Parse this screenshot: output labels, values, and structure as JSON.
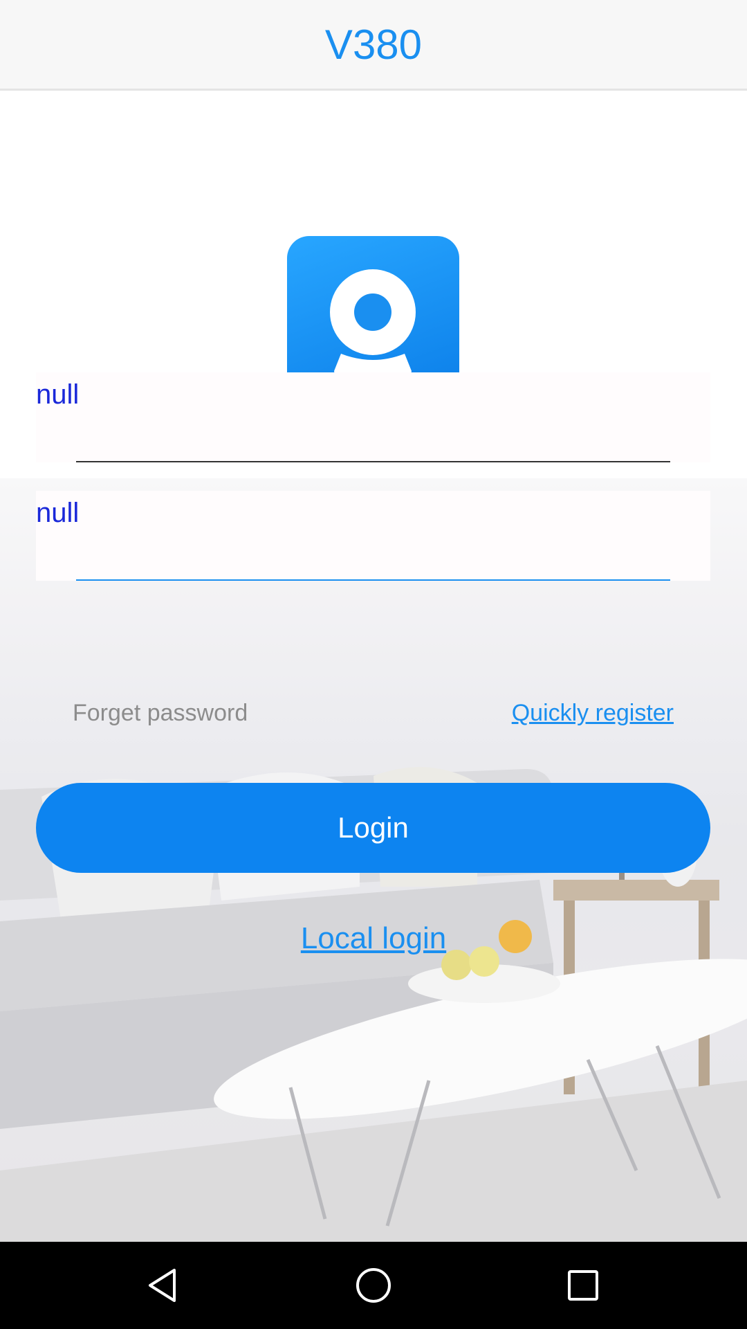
{
  "header": {
    "title": "V380"
  },
  "login_form": {
    "username_label": "null",
    "password_label": "null",
    "forget_password": "Forget password",
    "quick_register": "Quickly register",
    "login_button": "Login",
    "local_login": "Local login"
  },
  "logo": {
    "icon": "camera-icon",
    "color": "#0d84f0"
  },
  "colors": {
    "accent": "#1a8ff0",
    "label": "#1a28d9",
    "button": "#0d84f0"
  },
  "nav": {
    "icons": [
      "back-icon",
      "home-icon",
      "recents-icon"
    ]
  }
}
